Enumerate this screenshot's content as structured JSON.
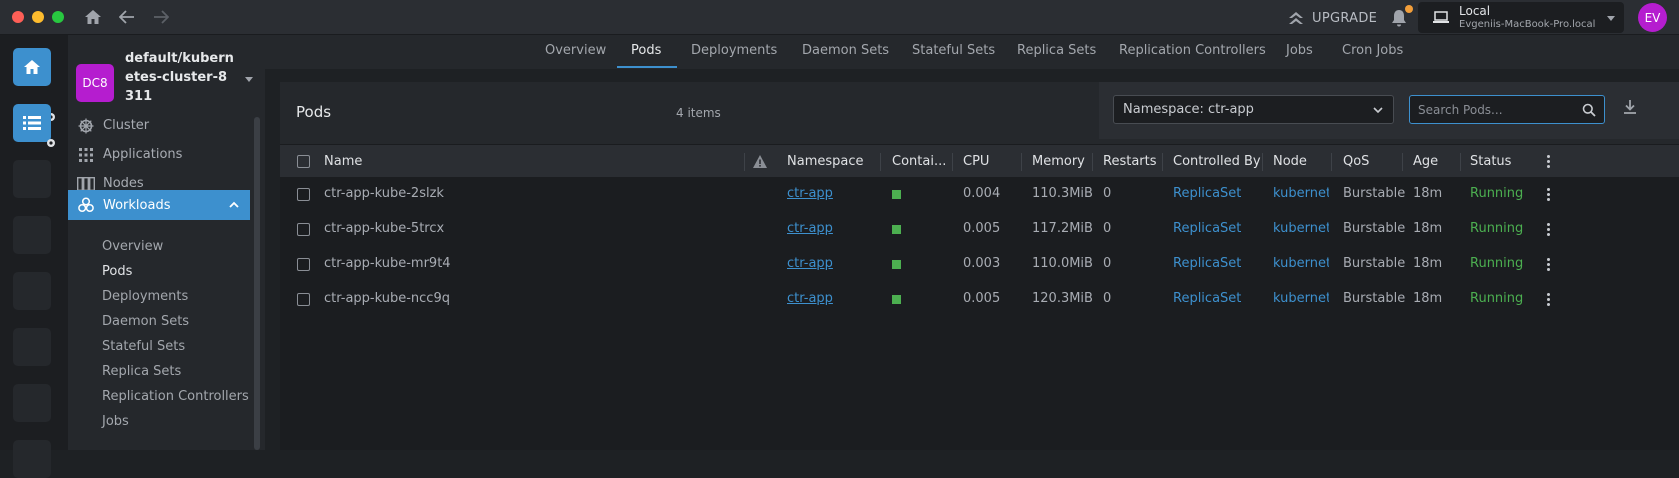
{
  "topbar": {
    "upgrade_label": "UPGRADE",
    "cluster_title": "Local",
    "cluster_host": "Evgeniis-MacBook-Pro.local",
    "avatar_initials": "EV",
    "colors": {
      "traffic_red": "#fe5f57",
      "traffic_yellow": "#febc2e",
      "traffic_green": "#28c840",
      "avatar": "#b51dcf",
      "notification": "#f29e3a"
    }
  },
  "sidebar": {
    "cluster_badge": "DC8",
    "cluster_name": "default/kubernetes-cluster-8311",
    "items": [
      {
        "label": "Cluster",
        "icon": "helm-wheel-icon"
      },
      {
        "label": "Applications",
        "icon": "grid-icon"
      },
      {
        "label": "Nodes",
        "icon": "nodes-icon"
      },
      {
        "label": "Workloads",
        "icon": "workloads-icon",
        "active": true
      }
    ],
    "workload_items": [
      "Overview",
      "Pods",
      "Deployments",
      "Daemon Sets",
      "Stateful Sets",
      "Replica Sets",
      "Replication Controllers",
      "Jobs"
    ]
  },
  "tabs": [
    "Overview",
    "Pods",
    "Deployments",
    "Daemon Sets",
    "Stateful Sets",
    "Replica Sets",
    "Replication Controllers",
    "Jobs",
    "Cron Jobs"
  ],
  "active_tab": "Pods",
  "panel": {
    "title": "Pods",
    "item_count": "4 items",
    "namespace_select": "Namespace: ctr-app",
    "search_placeholder": "Search Pods..."
  },
  "table": {
    "columns": [
      "Name",
      "Namespace",
      "Contai...",
      "CPU",
      "Memory",
      "Restarts",
      "Controlled By",
      "Node",
      "QoS",
      "Age",
      "Status"
    ],
    "rows": [
      {
        "name": "ctr-app-kube-2slzk",
        "namespace": "ctr-app",
        "cpu": "0.004",
        "memory": "110.3MiB",
        "restarts": "0",
        "controlled_by": "ReplicaSet",
        "node": "kubernetes",
        "qos": "Burstable",
        "age": "18m",
        "status": "Running"
      },
      {
        "name": "ctr-app-kube-5trcx",
        "namespace": "ctr-app",
        "cpu": "0.005",
        "memory": "117.2MiB",
        "restarts": "0",
        "controlled_by": "ReplicaSet",
        "node": "kubernetes",
        "qos": "Burstable",
        "age": "18m",
        "status": "Running"
      },
      {
        "name": "ctr-app-kube-mr9t4",
        "namespace": "ctr-app",
        "cpu": "0.003",
        "memory": "110.0MiB",
        "restarts": "0",
        "controlled_by": "ReplicaSet",
        "node": "kubernetes",
        "qos": "Burstable",
        "age": "18m",
        "status": "Running"
      },
      {
        "name": "ctr-app-kube-ncc9q",
        "namespace": "ctr-app",
        "cpu": "0.005",
        "memory": "120.3MiB",
        "restarts": "0",
        "controlled_by": "ReplicaSet",
        "node": "kubernetes",
        "qos": "Burstable",
        "age": "18m",
        "status": "Running"
      }
    ]
  },
  "colors": {
    "accent": "#3d90ce",
    "running": "#4caf50"
  }
}
